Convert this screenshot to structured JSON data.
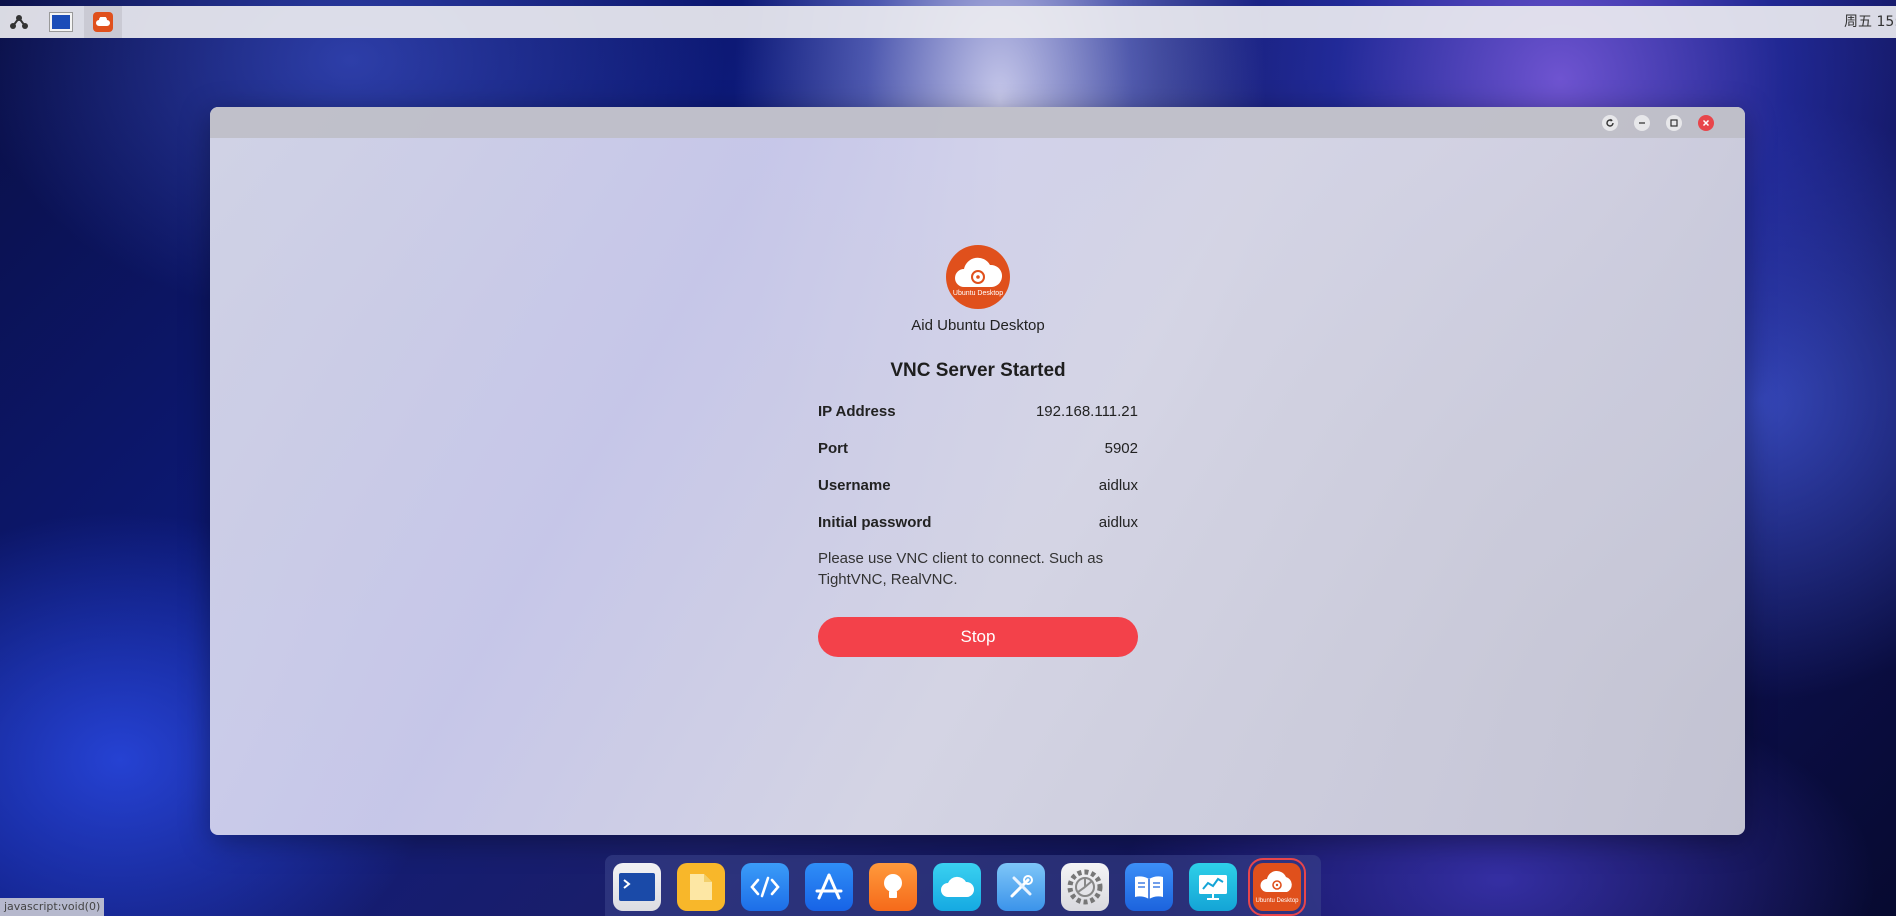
{
  "top_panel": {
    "clock": "周五 15:",
    "items": [
      "launcher-icon",
      "terminal-window-icon",
      "ubuntu-desktop-icon"
    ]
  },
  "window": {
    "app_name": "Aid Ubuntu Desktop",
    "logo_text": "Ubuntu Desktop",
    "title": "VNC Server Started",
    "rows": [
      {
        "key": "IP Address",
        "value": "192.168.111.21"
      },
      {
        "key": "Port",
        "value": "5902"
      },
      {
        "key": "Username",
        "value": "aidlux"
      },
      {
        "key": "Initial password",
        "value": "aidlux"
      }
    ],
    "note": "Please use VNC client to connect. Such as TightVNC, RealVNC.",
    "stop_label": "Stop"
  },
  "dock": {
    "items": [
      "terminal",
      "files",
      "code-editor",
      "app-store",
      "ideas",
      "cloud",
      "tools",
      "settings",
      "reader",
      "monitor",
      "ubuntu-desktop"
    ],
    "active_label": "Ubuntu Desktop"
  },
  "status_bar": {
    "url": "javascript:void(0)"
  },
  "colors": {
    "accent_red": "#f3414a",
    "logo_orange": "#e0501c"
  }
}
